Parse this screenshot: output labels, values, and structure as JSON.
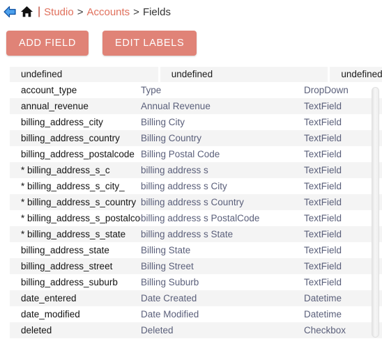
{
  "breadcrumb": {
    "back_icon": "back-arrow-icon",
    "home_icon": "home-icon",
    "pipe": "|",
    "items": [
      {
        "label": "Studio",
        "type": "link"
      },
      {
        "label": "Accounts",
        "type": "link"
      },
      {
        "label": "Fields",
        "type": "current"
      }
    ],
    "separator": ">"
  },
  "toolbar": {
    "add_field_label": "ADD FIELD",
    "edit_labels_label": "EDIT LABELS"
  },
  "colors": {
    "accent": "#e08377",
    "link": "#e0705c",
    "row_alt": "#f4f4f4",
    "cell_text": "#5a5f7a",
    "name_text": "#141414"
  },
  "table": {
    "headers": [
      "undefined",
      "undefined",
      "undefined"
    ],
    "header_truncated_3": "undefi",
    "columns": [
      "name",
      "label",
      "type"
    ],
    "rows": [
      {
        "name": "account_type",
        "label": "Type",
        "type": "DropDown"
      },
      {
        "name": "annual_revenue",
        "label": "Annual Revenue",
        "type": "TextField"
      },
      {
        "name": "billing_address_city",
        "label": "Billing City",
        "type": "TextField"
      },
      {
        "name": "billing_address_country",
        "label": "Billing Country",
        "type": "TextField"
      },
      {
        "name": "billing_address_postalcode",
        "label": "Billing Postal Code",
        "type": "TextField"
      },
      {
        "name": "* billing_address_s_c",
        "label": "billing address s",
        "type": "TextField"
      },
      {
        "name": "* billing_address_s_city_",
        "label": "billing address s City",
        "type": "TextField"
      },
      {
        "name": "* billing_address_s_country",
        "label": "billing address s Country",
        "type": "TextField"
      },
      {
        "name": "* billing_address_s_postalcode",
        "label": "billing address s PostalCode",
        "type": "TextField"
      },
      {
        "name": "* billing_address_s_state",
        "label": "billing address s State",
        "type": "TextField"
      },
      {
        "name": "billing_address_state",
        "label": "Billing State",
        "type": "TextField"
      },
      {
        "name": "billing_address_street",
        "label": "Billing Street",
        "type": "TextField"
      },
      {
        "name": "billing_address_suburb",
        "label": "Billing Suburb",
        "type": "TextField"
      },
      {
        "name": "date_entered",
        "label": "Date Created",
        "type": "Datetime"
      },
      {
        "name": "date_modified",
        "label": "Date Modified",
        "type": "Datetime"
      },
      {
        "name": "deleted",
        "label": "Deleted",
        "type": "Checkbox"
      }
    ]
  },
  "scrollbar": {
    "orientation": "vertical"
  }
}
